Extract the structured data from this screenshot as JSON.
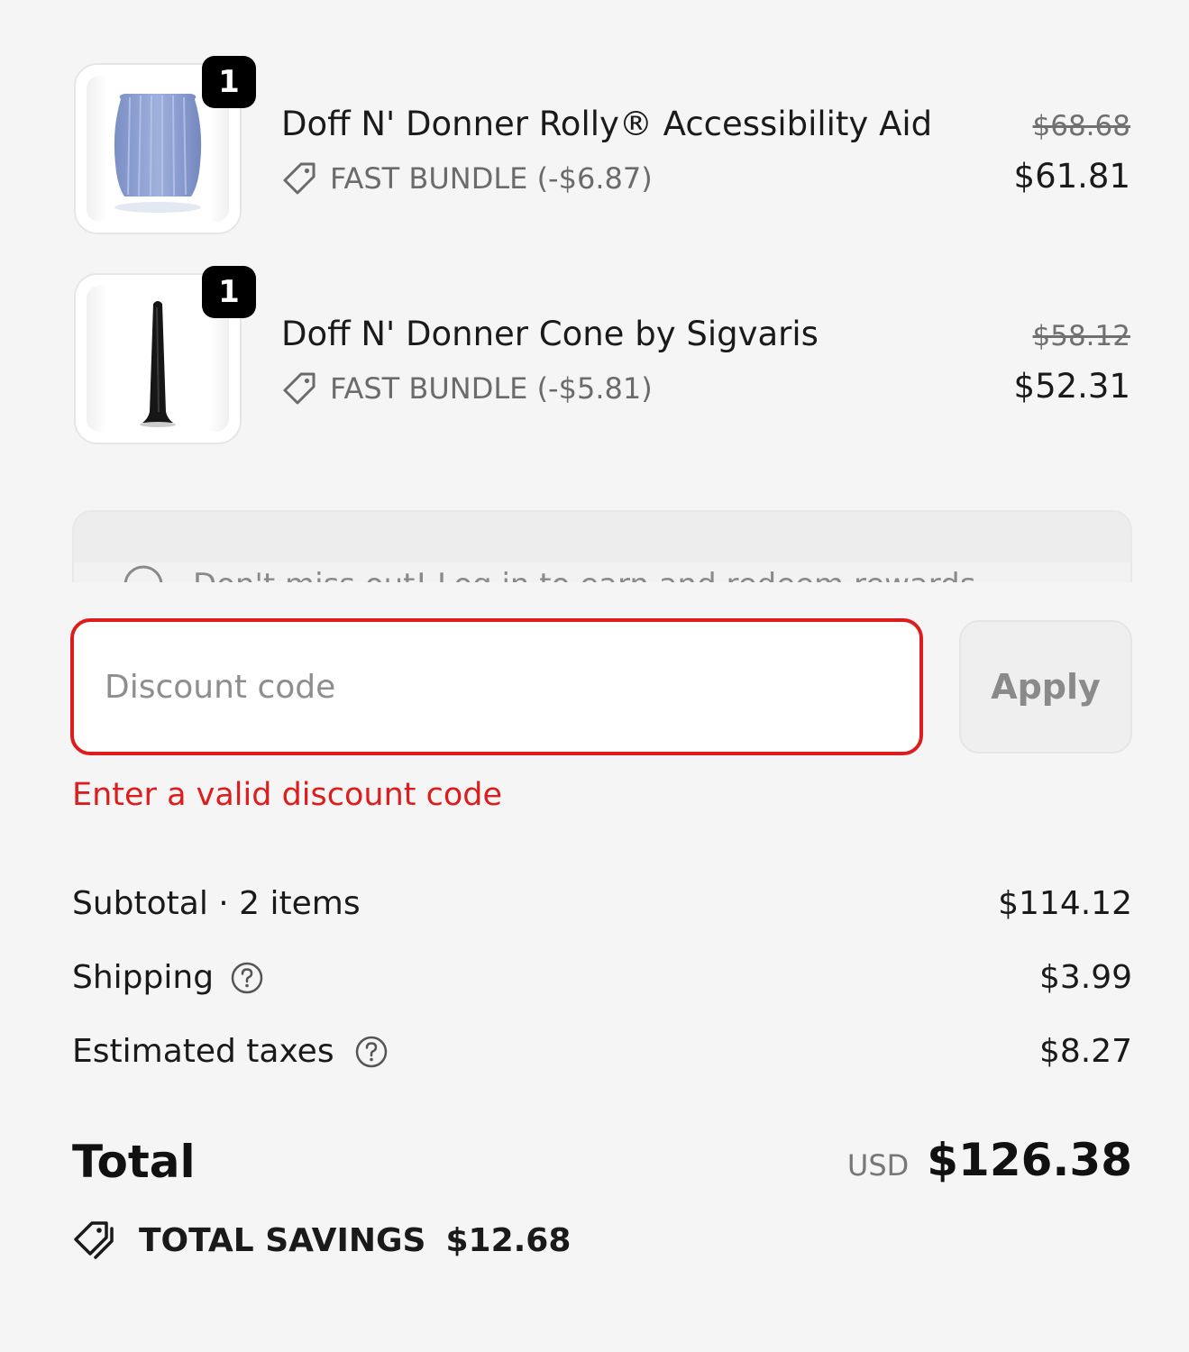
{
  "line_items": [
    {
      "quantity": "1",
      "name": "Doff N' Donner Rolly® Accessibility Aid",
      "discount_label": "FAST BUNDLE (-$6.87)",
      "original_price": "$68.68",
      "price": "$61.81",
      "image_icon": "blue-ribbed-cup-image"
    },
    {
      "quantity": "1",
      "name": "Doff N' Donner Cone by Sigvaris",
      "discount_label": "FAST BUNDLE (-$5.81)",
      "original_price": "$58.12",
      "price": "$52.31",
      "image_icon": "black-cone-image"
    }
  ],
  "rewards_banner": {
    "text": "Don't miss out! Log in to earn and redeem rewards"
  },
  "discount": {
    "placeholder": "Discount code",
    "value": "",
    "apply_label": "Apply",
    "error": "Enter a valid discount code"
  },
  "summary": {
    "subtotal_label": "Subtotal · 2 items",
    "subtotal_value": "$114.12",
    "shipping_label": "Shipping",
    "shipping_value": "$3.99",
    "taxes_label": "Estimated taxes",
    "taxes_value": "$8.27",
    "total_label": "Total",
    "currency": "USD",
    "total_value": "$126.38",
    "savings_label": "TOTAL SAVINGS",
    "savings_value": "$12.68"
  },
  "colors": {
    "background": "#f5f5f5",
    "error": "#dd1d1d",
    "text": "#1a1a1a",
    "muted": "#6b6b6b"
  }
}
